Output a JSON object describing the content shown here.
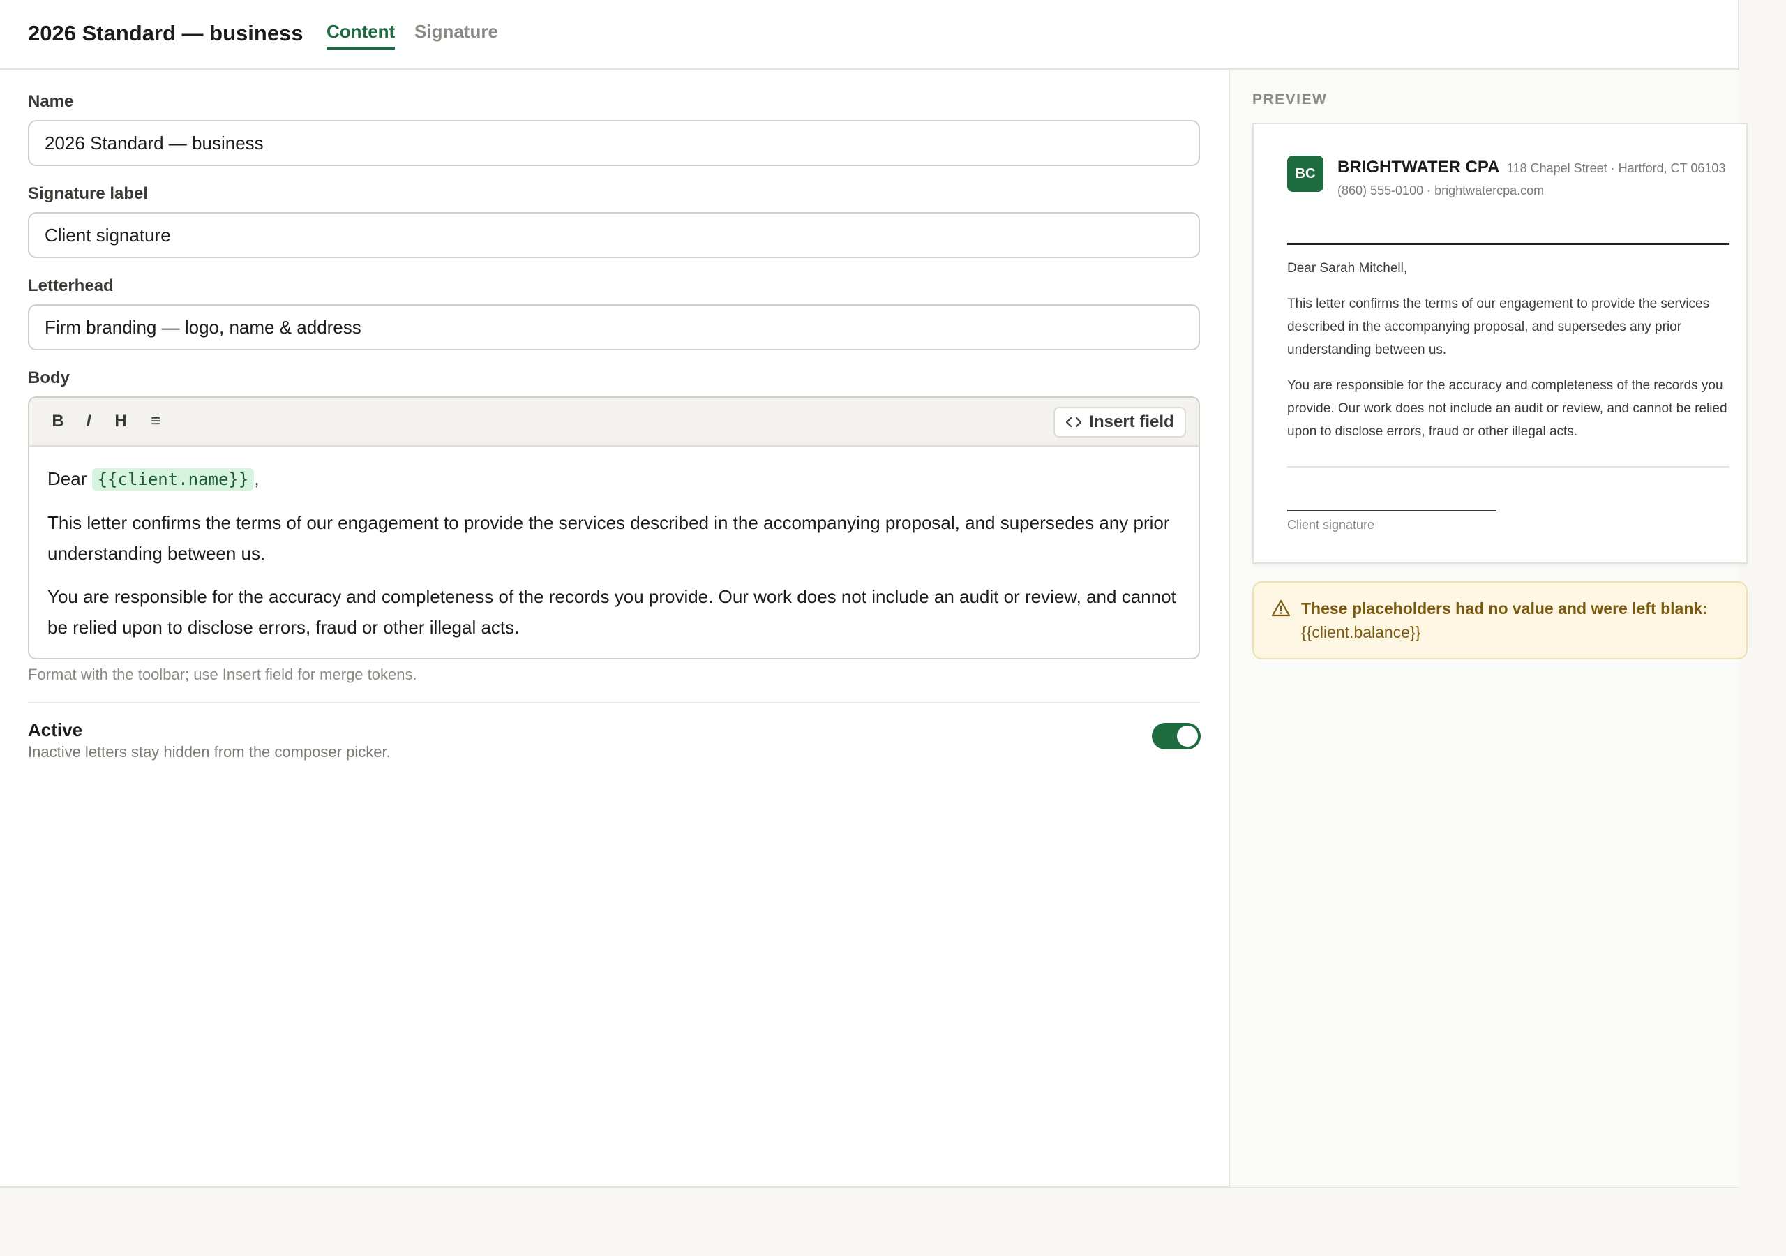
{
  "header": {
    "title": "2026 Standard — business",
    "tabs": [
      {
        "label": "Content",
        "active": true
      },
      {
        "label": "Signature",
        "active": false
      }
    ]
  },
  "form": {
    "name_label": "Name",
    "name_value": "2026 Standard — business",
    "signature_label_label": "Signature label",
    "signature_label_value": "Client signature",
    "letterhead_label": "Letterhead",
    "letterhead_value": "Firm branding — logo, name & address",
    "body_label": "Body",
    "toolbar": {
      "bold": "B",
      "italic": "I",
      "heading": "H",
      "list": "≡",
      "insert_field": "Insert field"
    },
    "body": {
      "greeting_prefix": "Dear",
      "greeting_token": "{{client.name}}",
      "greeting_suffix": ",",
      "paragraph1": "This letter confirms the terms of our engagement to provide the services described in the accompanying proposal, and supersedes any prior understanding between us.",
      "paragraph2": "You are responsible for the accuracy and completeness of the records you provide. Our work does not include an audit or review, and cannot be relied upon to disclose errors, fraud or other illegal acts."
    },
    "hint": "Format with the toolbar; use Insert field for merge tokens.",
    "active_title": "Active",
    "active_subtitle": "Inactive letters stay hidden from the composer picker.",
    "active_on": true
  },
  "preview": {
    "label": "PREVIEW",
    "logo_initials": "BC",
    "firm_name": "BRIGHTWATER CPA",
    "firm_address": "118 Chapel Street · Hartford, CT 06103",
    "firm_contact": "(860) 555-0100 · brightwatercpa.com",
    "greeting": "Dear Sarah Mitchell,",
    "paragraph1": "This letter confirms the terms of our engagement to provide the services described in the accompanying proposal, and supersedes any prior understanding between us.",
    "paragraph2": "You are responsible for the accuracy and completeness of the records you provide. Our work does not include an audit or review, and cannot be relied upon to disclose errors, fraud or other illegal acts.",
    "signature_label": "Client signature"
  },
  "warning": {
    "message": "These placeholders had no value and were left blank:",
    "placeholders": "{{client.balance}}"
  },
  "colors": {
    "accent": "#1d6b3f",
    "warning_bg": "#fdf6e3",
    "warning_text": "#7a5a10",
    "token_bg": "#d6f3df"
  }
}
